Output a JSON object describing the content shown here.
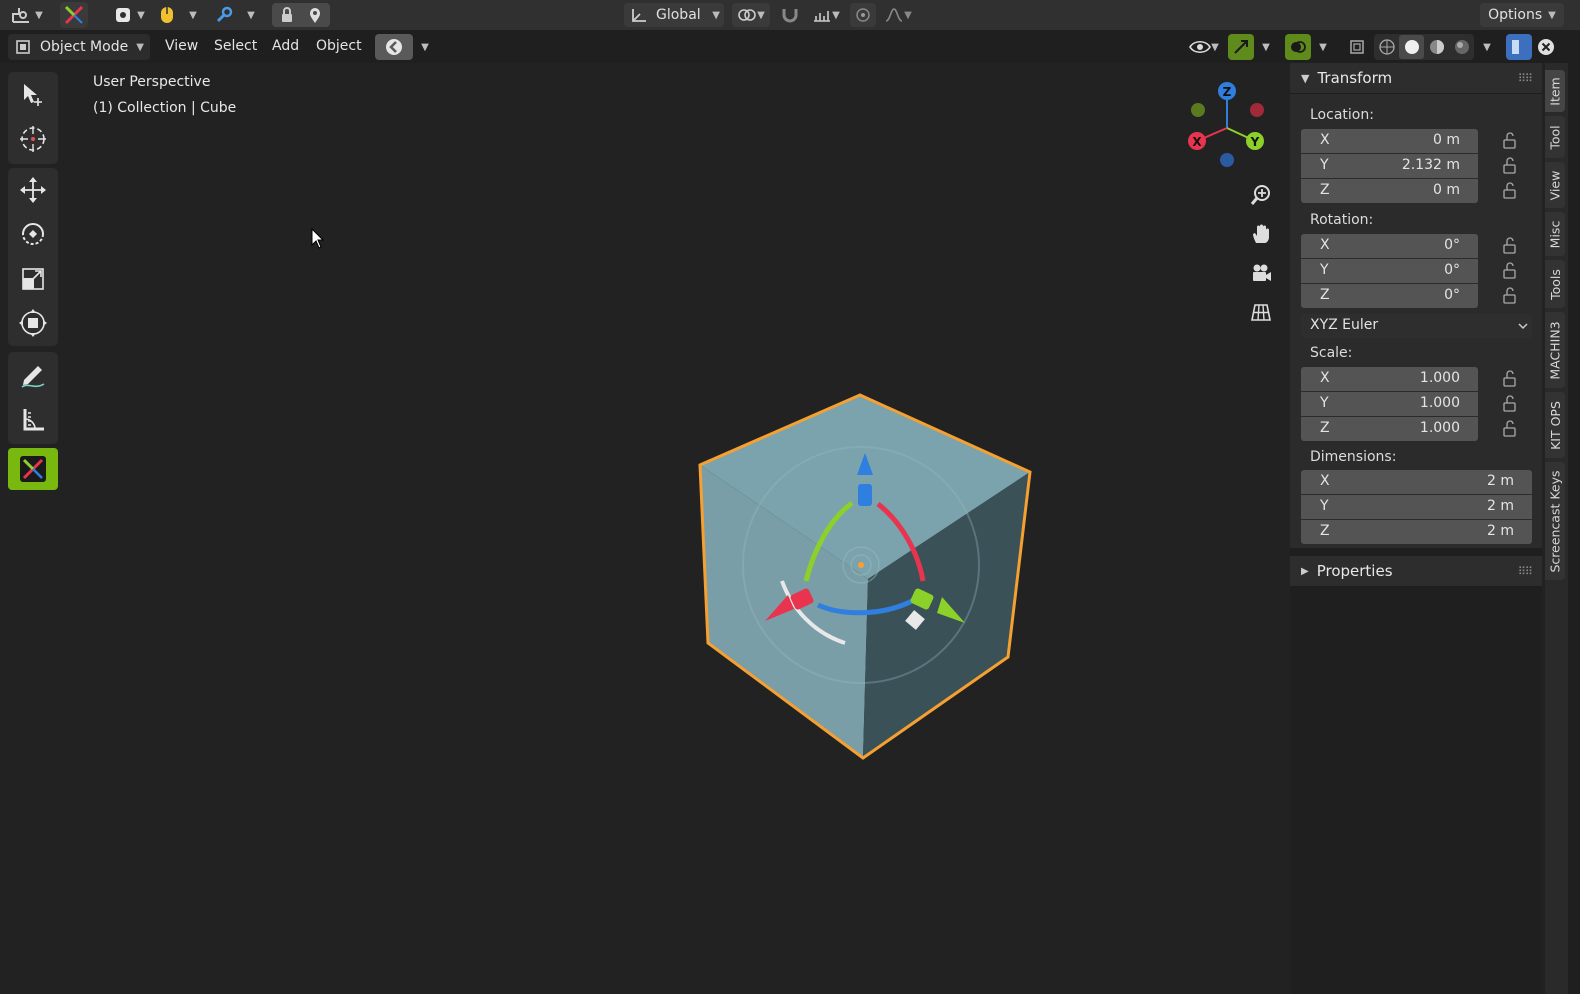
{
  "header": {
    "transform_orientation": "Global",
    "options_label": "Options"
  },
  "viewport_header": {
    "mode": "Object Mode",
    "menus": [
      "View",
      "Select",
      "Add",
      "Object"
    ]
  },
  "viewport": {
    "overlay_line1": "User Perspective",
    "overlay_line2": "(1) Collection | Cube",
    "gizmo_axes": {
      "x": "X",
      "y": "Y",
      "z": "Z"
    }
  },
  "npanel": {
    "transform_title": "Transform",
    "location": {
      "label": "Location:",
      "rows": [
        {
          "axis": "X",
          "value": "0 m"
        },
        {
          "axis": "Y",
          "value": "2.132 m"
        },
        {
          "axis": "Z",
          "value": "0 m"
        }
      ]
    },
    "rotation": {
      "label": "Rotation:",
      "rows": [
        {
          "axis": "X",
          "value": "0°"
        },
        {
          "axis": "Y",
          "value": "0°"
        },
        {
          "axis": "Z",
          "value": "0°"
        }
      ],
      "mode": "XYZ Euler"
    },
    "scale": {
      "label": "Scale:",
      "rows": [
        {
          "axis": "X",
          "value": "1.000"
        },
        {
          "axis": "Y",
          "value": "1.000"
        },
        {
          "axis": "Z",
          "value": "1.000"
        }
      ]
    },
    "dimensions": {
      "label": "Dimensions:",
      "rows": [
        {
          "axis": "X",
          "value": "2 m"
        },
        {
          "axis": "Y",
          "value": "2 m"
        },
        {
          "axis": "Z",
          "value": "2 m"
        }
      ]
    },
    "properties_title": "Properties"
  },
  "side_tabs": [
    "Item",
    "Tool",
    "View",
    "Misc",
    "Tools",
    "MACHIN3",
    "KIT OPS",
    "Screencast Keys"
  ],
  "colors": {
    "axis_x": "#e8344f",
    "axis_y": "#8bd12a",
    "axis_z": "#2f7fe0",
    "selection_outline": "#f5a030",
    "active_tool": "#78b80f",
    "cube_light": "#7aa3ad",
    "cube_dark": "#3a5157"
  }
}
